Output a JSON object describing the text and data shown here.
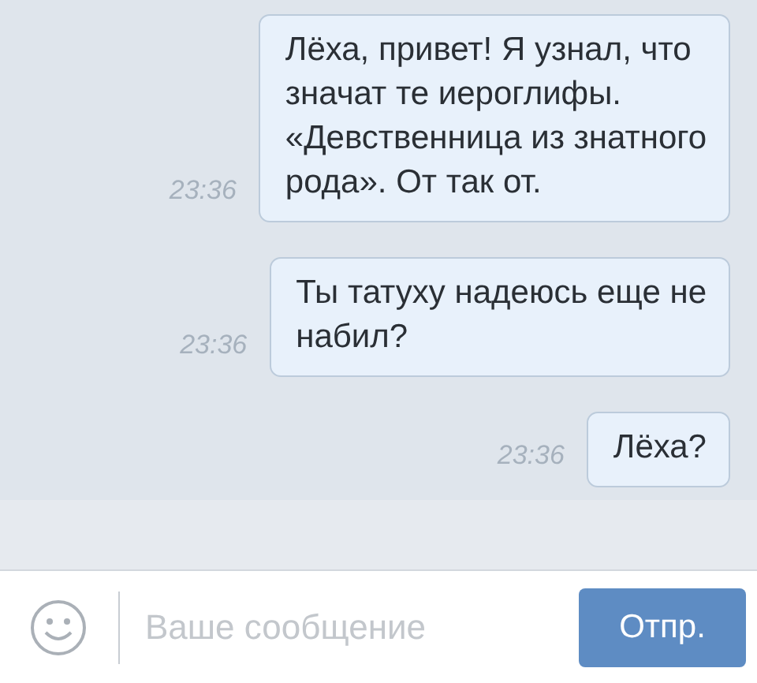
{
  "messages": [
    {
      "text": "Лёха, привет! Я узнал, что\nзначат те иероглифы.\n«Девственница из знатного\nрода». От так от.",
      "time": "23:36"
    },
    {
      "text": "Ты татуху надеюсь еще не\nнабил?",
      "time": "23:36"
    },
    {
      "text": "Лёха?",
      "time": "23:36"
    }
  ],
  "composer": {
    "placeholder": "Ваше сообщение",
    "send": "Отпр."
  }
}
